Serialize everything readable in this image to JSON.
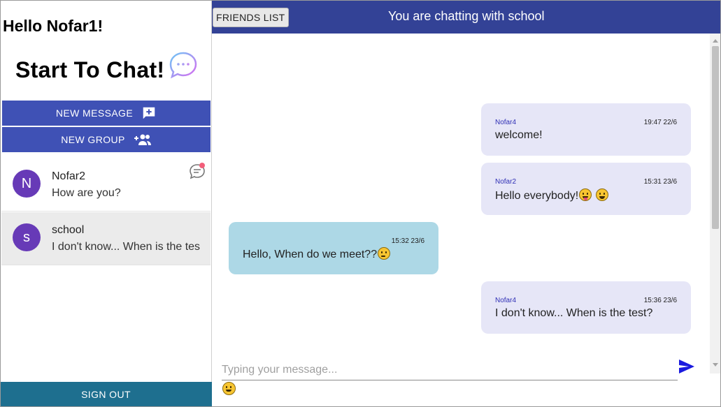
{
  "sidebar": {
    "greeting": "Hello Nofar1!",
    "heading": "Start To Chat!",
    "new_message_label": "NEW MESSAGE",
    "new_group_label": "NEW GROUP",
    "sign_out_label": "SIGN OUT",
    "contacts": [
      {
        "initial": "N",
        "name": "Nofar2",
        "preview": "How are you?",
        "unread": true
      },
      {
        "initial": "s",
        "name": "school",
        "preview": "I don't know... When is the test?",
        "active": true
      }
    ]
  },
  "header": {
    "friends_label": "FRIENDS LIST",
    "title": "You are chatting with school"
  },
  "messages": [
    {
      "sender": "Nofar4",
      "time": "19:47 22/6",
      "text": "welcome!",
      "direction": "incoming-other"
    },
    {
      "sender": "Nofar2",
      "time": "15:31 23/6",
      "text": "Hello everybody!",
      "emojis": [
        "tongue-emoji",
        "grin-emoji"
      ]
    },
    {
      "sender": "",
      "time": "15:32 23/6",
      "text": "Hello, When do we meet??",
      "emojis": [
        "thinking-emoji"
      ],
      "own": true
    },
    {
      "sender": "Nofar4",
      "time": "15:36 23/6",
      "text": "I don't know... When is the test?"
    }
  ],
  "composer": {
    "placeholder": "Typing your message...",
    "value": ""
  },
  "colors": {
    "primary": "#3f51b5",
    "header": "#334296",
    "sign_out": "#1e6f8f",
    "avatar": "#673ab7",
    "own_bubble": "#add8e6",
    "other_bubble": "#e6e6f7",
    "send_icon": "#1a1adf"
  }
}
